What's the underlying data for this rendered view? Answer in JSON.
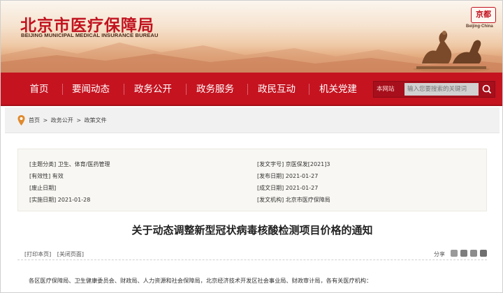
{
  "header": {
    "title_cn": "北京市医疗保障局",
    "title_en": "BEIJING MUNICIPAL MEDICAL INSURANCE BUREAU",
    "stamp_text": "京都",
    "stamp_sub": "Beijing·China"
  },
  "nav": {
    "items": [
      {
        "label": "首页"
      },
      {
        "label": "要闻动态"
      },
      {
        "label": "政务公开"
      },
      {
        "label": "政务服务"
      },
      {
        "label": "政民互动"
      },
      {
        "label": "机关党建"
      }
    ],
    "search": {
      "scope_label": "本网站",
      "placeholder": "输入您要搜索的关键词"
    },
    "colors": {
      "bar": "#c51320"
    }
  },
  "breadcrumb": {
    "items": [
      "首页",
      "政务公开",
      "政策文件"
    ],
    "separator": ">"
  },
  "meta": {
    "left": [
      {
        "key": "[主题分类]",
        "value": "卫生、体育/医药管理"
      },
      {
        "key": "[有效性]",
        "value": "有效"
      },
      {
        "key": "[废止日期]",
        "value": ""
      },
      {
        "key": "[实施日期]",
        "value": "2021-01-28"
      }
    ],
    "right": [
      {
        "key": "[发文字号]",
        "value": "京医保发[2021]3"
      },
      {
        "key": "[发布日期]",
        "value": "2021-01-27"
      },
      {
        "key": "[成文日期]",
        "value": "2021-01-27"
      },
      {
        "key": "[发文机构]",
        "value": "北京市医疗保障局"
      }
    ]
  },
  "article": {
    "title": "关于动态调整新型冠状病毒核酸检测项目价格的通知",
    "print_label": "[打印本页]",
    "close_label": "[关闭页面]",
    "share_label": "分享",
    "share_icons": [
      "weixin-icon",
      "weibo-icon",
      "qq-icon",
      "qzone-icon"
    ],
    "first_line": "各区医疗保障局、卫生健康委员会、财政局、人力资源和社会保障局，北京经济技术开发区社会事业局、财政审计局，各有关医疗机构："
  }
}
